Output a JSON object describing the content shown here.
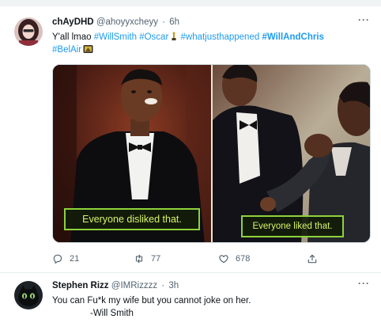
{
  "tweets": [
    {
      "display_name": "chAyDHD",
      "handle": "@ahoyyxcheyy",
      "separator": "·",
      "time": "6h",
      "text_prefix": "Y'all lmao ",
      "hashtags": {
        "willsmith": "#WillSmith",
        "oscar": "#Oscar",
        "whatjusthappened": "#whatjusthappened",
        "willandchris": "#WillAndChris",
        "belair": "#BelAir"
      },
      "media": {
        "left_caption": "Everyone disliked that.",
        "right_caption": "Everyone liked that."
      },
      "stats": {
        "replies": "21",
        "retweets": "77",
        "likes": "678"
      }
    },
    {
      "display_name": "Stephen Rizz",
      "handle": "@IMRizzzz",
      "separator": "·",
      "time": "3h",
      "text_line1": "You can Fu*k my wife but you cannot joke on her.",
      "text_line2": "-Will Smith"
    }
  ],
  "icons": {
    "more": "ellipsis-icon",
    "reply": "reply-icon",
    "retweet": "retweet-icon",
    "like": "heart-icon",
    "share": "share-icon",
    "emoji_oscar": "trophy-emoji",
    "emoji_tv": "tv-emoji"
  },
  "colors": {
    "link": "#1d9bf0",
    "secondary_text": "#536471",
    "caption_text": "#d6f46a",
    "caption_border": "#8ed23b"
  }
}
